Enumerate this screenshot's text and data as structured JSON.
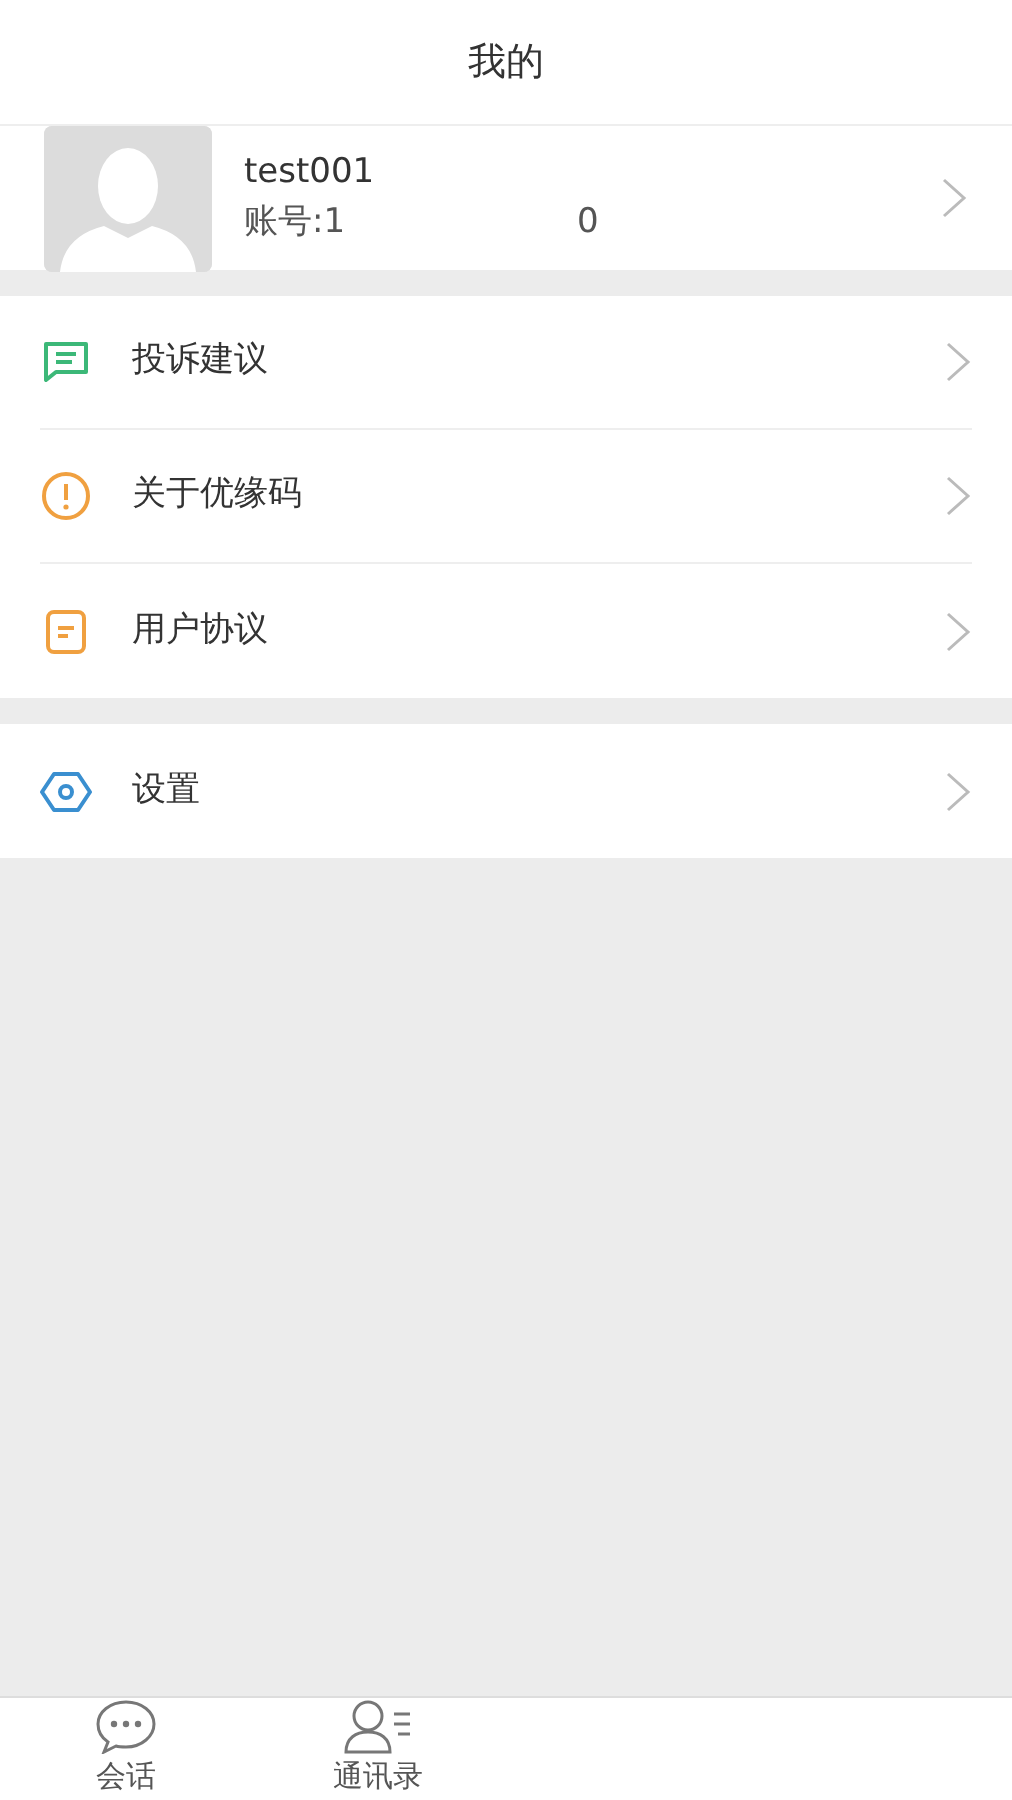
{
  "header": {
    "title": "我的"
  },
  "profile": {
    "username": "test001",
    "account_label": "账号:1",
    "account_tail": "0"
  },
  "groups": [
    {
      "items": [
        {
          "label": "投诉建议"
        },
        {
          "label": "关于优缘码"
        },
        {
          "label": "用户协议"
        }
      ]
    },
    {
      "items": [
        {
          "label": "设置"
        }
      ]
    }
  ],
  "tab_bar": [
    {
      "label": "会话"
    },
    {
      "label": "通讯录"
    }
  ]
}
